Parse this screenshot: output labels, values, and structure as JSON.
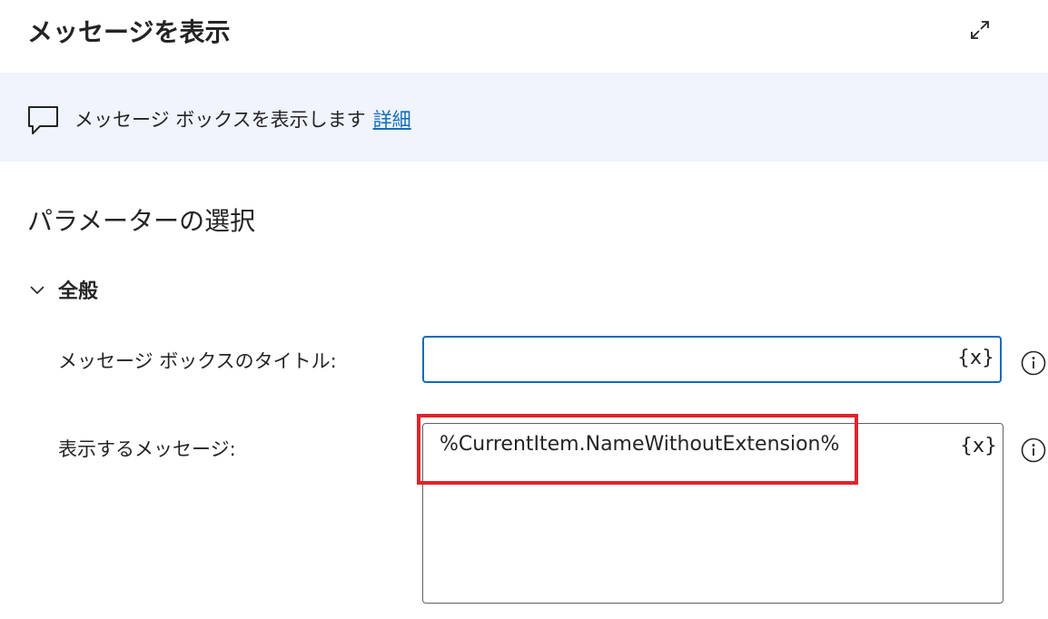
{
  "header": {
    "title": "メッセージを表示",
    "expand_icon": "expand-diagonal-icon"
  },
  "banner": {
    "icon": "speech-bubble-icon",
    "text": "メッセージ ボックスを表示します",
    "link": "詳細"
  },
  "parameters": {
    "section_title": "パラメーターの選択",
    "group": {
      "label": "全般",
      "expanded": true,
      "icon": "chevron-down-icon"
    },
    "fields": [
      {
        "label": "メッセージ ボックスのタイトル:",
        "value": "",
        "variable_button": "{x}",
        "info_icon": "info-icon"
      },
      {
        "label": "表示するメッセージ:",
        "value": "%CurrentItem.NameWithoutExtension%",
        "variable_button": "{x}",
        "info_icon": "info-icon"
      }
    ]
  },
  "colors": {
    "banner_bg": "#eff4fd",
    "link": "#0f6cbd",
    "focus_border": "#0f6cbd",
    "highlight": "#e0242a"
  }
}
